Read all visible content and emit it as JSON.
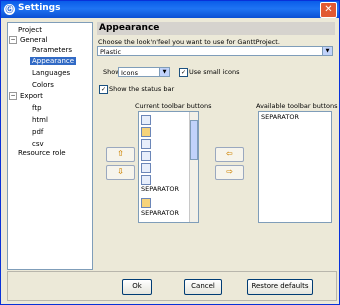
{
  "window": {
    "title": "Settings",
    "close_glyph": "✕",
    "app_icon_glyph": "Ⓖ"
  },
  "tree": {
    "items": [
      {
        "label": "Project"
      },
      {
        "label": "General",
        "expander": "−"
      },
      {
        "label": "Parameters"
      },
      {
        "label": "Appearance",
        "selected": true
      },
      {
        "label": "Languages"
      },
      {
        "label": "Colors"
      },
      {
        "label": "Export",
        "expander": "−"
      },
      {
        "label": "ftp"
      },
      {
        "label": "html"
      },
      {
        "label": "pdf"
      },
      {
        "label": "csv"
      },
      {
        "label": "Resource role"
      }
    ]
  },
  "appearance": {
    "header": "Appearance",
    "description": "Choose the look'n'feel you want to use for GanttProject.",
    "look_feel_value": "Plastic",
    "show_label": "Show",
    "show_value": "Icons",
    "use_small_icons_label": "Use small icons",
    "use_small_icons_checked": true,
    "show_status_bar_label": "Show the status bar",
    "show_status_bar_checked": true,
    "current_toolbar_label": "Current toolbar buttons",
    "available_toolbar_label": "Available toolbar buttons",
    "current_items": [
      "SEPARATOR",
      "SEPARATOR"
    ],
    "available_items": [
      "SEPARATOR"
    ]
  },
  "buttons": {
    "ok": "Ok",
    "cancel": "Cancel",
    "restore": "Restore defaults"
  }
}
